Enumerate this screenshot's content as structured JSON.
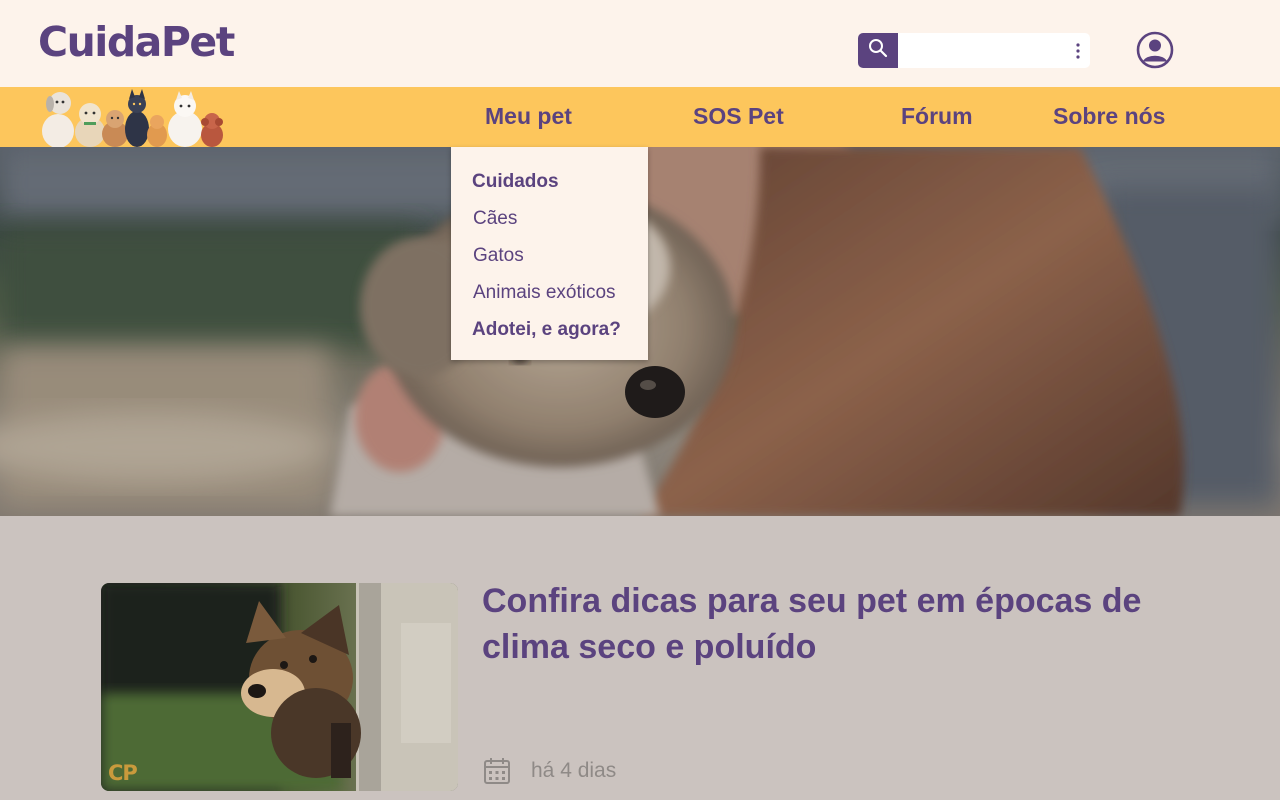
{
  "brand": {
    "name": "CuidaPet"
  },
  "search": {
    "placeholder": "",
    "icon": "search-icon",
    "menu_icon": "vertical-dots-icon"
  },
  "user": {
    "icon": "user-profile-icon"
  },
  "nav": {
    "items": [
      {
        "label": "Meu pet"
      },
      {
        "label": "SOS Pet"
      },
      {
        "label": "Fórum"
      },
      {
        "label": "Sobre nós"
      }
    ]
  },
  "dropdown": {
    "items": [
      {
        "label": "Cuidados"
      },
      {
        "label": "Cães"
      },
      {
        "label": "Gatos"
      },
      {
        "label": "Animais exóticos"
      },
      {
        "label": "Adotei, e agora?"
      }
    ]
  },
  "article": {
    "title": "Confira dicas para seu pet em épocas de clima seco e poluído",
    "date": "há 4 dias",
    "thumb_mark": "CP",
    "date_icon": "calendar-icon"
  },
  "colors": {
    "primary": "#5b437f",
    "nav_bg": "#fdc65c",
    "header_bg": "#fdf3eb",
    "page_bg": "#cbc3bf",
    "muted_text": "#8f8a87",
    "mark": "#c99a3c"
  }
}
